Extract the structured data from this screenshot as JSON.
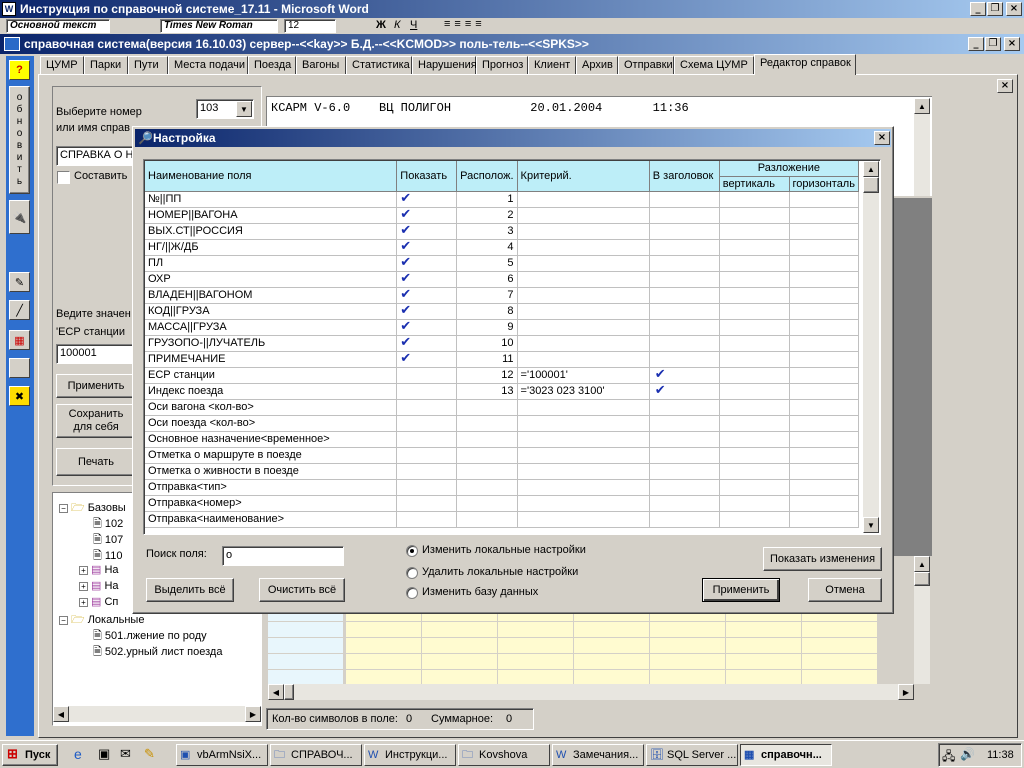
{
  "word": {
    "title": "Инструкция по справочной системе_17.11 - Microsoft Word",
    "style_box": "Основной текст",
    "font_box": "Times New Roman",
    "size_box": "12"
  },
  "app": {
    "title": "справочная система(версия 16.10.03) сервер--<<kay>> Б.Д.--<<KCMOD>> поль-тель--<<SPKS>>",
    "tabs": [
      "ЦУМР",
      "Парки",
      "Пути",
      "Места подачи",
      "Поезда",
      "Вагоны",
      "Статистика",
      "Нарушения",
      "Прогноз",
      "Клиент",
      "Архив",
      "Отправки",
      "Схема ЦУМР",
      "Редактор справок"
    ],
    "active_tab": "Редактор справок",
    "side_refresh": [
      "о",
      "б",
      "н",
      "о",
      "в",
      "и",
      "т",
      "ь"
    ],
    "help_btn": "?"
  },
  "left": {
    "select_label_1": "Выберите номер",
    "select_label_2": "или имя справ",
    "number_value": "103",
    "name_value": "СПРАВКА О Н",
    "compose_label": "Составить",
    "enter_value_label": "Ведите значен",
    "ecr_label": "'ЕСР станции",
    "ecr_value": "100001",
    "apply_btn": "Применить",
    "save_btn_1": "Сохранить",
    "save_btn_2": "для себя",
    "print_btn": "Печать"
  },
  "tree": {
    "items": [
      {
        "label": "Базовы",
        "indent": 0,
        "icon": "folder-open"
      },
      {
        "label": "102",
        "indent": 1,
        "icon": "doc"
      },
      {
        "label": "107",
        "indent": 1,
        "icon": "doc"
      },
      {
        "label": "110",
        "indent": 1,
        "icon": "doc"
      },
      {
        "label": "На",
        "indent": 1,
        "icon": "plus-folder"
      },
      {
        "label": "На",
        "indent": 1,
        "icon": "plus-folder"
      },
      {
        "label": "Сп",
        "indent": 1,
        "icon": "plus-folder"
      },
      {
        "label": "Локальные",
        "indent": 0,
        "icon": "folder-open"
      },
      {
        "label": "501.лжение по роду",
        "indent": 1,
        "icon": "doc"
      },
      {
        "label": "502.урный лист поезда",
        "indent": 1,
        "icon": "doc"
      }
    ]
  },
  "report": {
    "line": "КСАРМ V-6.0    ВЦ ПОЛИГОН           20.01.2004       11:36"
  },
  "status": {
    "chars_label": "Кол-во символов в поле:",
    "chars_value": "0",
    "sum_label": "Суммарное:",
    "sum_value": "0"
  },
  "dialog": {
    "title": "Настройка",
    "columns": {
      "name": "Наименование поля",
      "show": "Показать",
      "pos": "Располож.",
      "criteria": "Критерий.",
      "in_header": "В заголовок",
      "layout": "Разложение",
      "vertical": "вертикаль",
      "horizontal": "горизонталь"
    },
    "rows": [
      {
        "name": "№||ПП",
        "show": true,
        "pos": "1",
        "crit": "",
        "head": false
      },
      {
        "name": "НОМЕР||ВАГОНА",
        "show": true,
        "pos": "2",
        "crit": "",
        "head": false
      },
      {
        "name": "ВЫХ.СТ||РОССИЯ",
        "show": true,
        "pos": "3",
        "crit": "",
        "head": false
      },
      {
        "name": "НГ/||Ж/ДБ",
        "show": true,
        "pos": "4",
        "crit": "",
        "head": false
      },
      {
        "name": "ПЛ",
        "show": true,
        "pos": "5",
        "crit": "",
        "head": false
      },
      {
        "name": "ОХР",
        "show": true,
        "pos": "6",
        "crit": "",
        "head": false
      },
      {
        "name": "ВЛАДЕН||ВАГОНОМ",
        "show": true,
        "pos": "7",
        "crit": "",
        "head": false
      },
      {
        "name": "КОД||ГРУЗА",
        "show": true,
        "pos": "8",
        "crit": "",
        "head": false
      },
      {
        "name": "МАССА||ГРУЗА",
        "show": true,
        "pos": "9",
        "crit": "",
        "head": false
      },
      {
        "name": "ГРУЗОПО-||ЛУЧАТЕЛЬ",
        "show": true,
        "pos": "10",
        "crit": "",
        "head": false
      },
      {
        "name": "ПРИМЕЧАНИЕ",
        "show": true,
        "pos": "11",
        "crit": "",
        "head": false
      },
      {
        "name": "ЕСР станции",
        "show": false,
        "pos": "12",
        "crit": "='100001'",
        "head": true
      },
      {
        "name": "Индекс поезда",
        "show": false,
        "pos": "13",
        "crit": "='3023 023 3100'",
        "head": true
      },
      {
        "name": "Оси вагона <кол-во>",
        "show": false,
        "pos": "",
        "crit": "",
        "head": false
      },
      {
        "name": "Оси поезда <кол-во>",
        "show": false,
        "pos": "",
        "crit": "",
        "head": false
      },
      {
        "name": "Основное назначение<временное>",
        "show": false,
        "pos": "",
        "crit": "",
        "head": false
      },
      {
        "name": "Отметка о маршруте в поезде",
        "show": false,
        "pos": "",
        "crit": "",
        "head": false
      },
      {
        "name": "Отметка о живности в поезде",
        "show": false,
        "pos": "",
        "crit": "",
        "head": false
      },
      {
        "name": "Отправка<тип>",
        "show": false,
        "pos": "",
        "crit": "",
        "head": false
      },
      {
        "name": "Отправка<номер>",
        "show": false,
        "pos": "",
        "crit": "",
        "head": false
      },
      {
        "name": "Отправка<наименование>",
        "show": false,
        "pos": "",
        "crit": "",
        "head": false
      }
    ],
    "search_label": "Поиск поля:",
    "search_value": "о",
    "select_all_btn": "Выделить всё",
    "clear_all_btn": "Очистить всё",
    "radio": [
      {
        "label": "Изменить локальные настройки",
        "checked": true
      },
      {
        "label": "Удалить локальные настройки",
        "checked": false
      },
      {
        "label": "Изменить базу данных",
        "checked": false
      }
    ],
    "show_changes_btn": "Показать изменения",
    "apply_btn": "Применить",
    "cancel_btn": "Отмена"
  },
  "taskbar": {
    "start": "Пуск",
    "items": [
      {
        "label": "vbArmNsiX...",
        "active": false
      },
      {
        "label": "СПРАВОЧ...",
        "active": false
      },
      {
        "label": "Инструкци...",
        "active": false
      },
      {
        "label": "Kovshova",
        "active": false
      },
      {
        "label": "Замечания...",
        "active": false
      },
      {
        "label": "SQL Server ...",
        "active": false
      },
      {
        "label": "справочн...",
        "active": true
      }
    ],
    "clock": "11:38"
  },
  "colors": {
    "header_cyan": "#bdeef8",
    "check_blue": "#1a2fb0",
    "title_blue": "#0a246a",
    "grid_yellow": "#fffbd0"
  }
}
